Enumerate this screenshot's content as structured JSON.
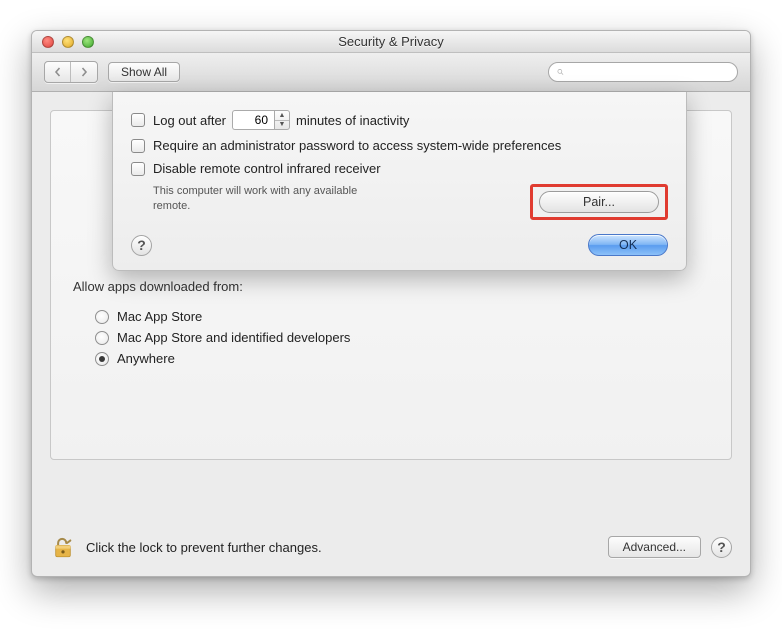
{
  "window": {
    "title": "Security & Privacy"
  },
  "toolbar": {
    "show_all_label": "Show All",
    "search_placeholder": ""
  },
  "sheet": {
    "logout": {
      "label_before": "Log out after",
      "value": "60",
      "label_after": "minutes of inactivity",
      "checked": false
    },
    "admin": {
      "label": "Require an administrator password to access system-wide preferences",
      "checked": false
    },
    "infrared": {
      "label": "Disable remote control infrared receiver",
      "checked": false,
      "note": "This computer will work with any available remote."
    },
    "pair_label": "Pair...",
    "ok_label": "OK"
  },
  "main": {
    "download_section_title": "Allow apps downloaded from:",
    "options": [
      {
        "label": "Mac App Store",
        "checked": false
      },
      {
        "label": "Mac App Store and identified developers",
        "checked": false
      },
      {
        "label": "Anywhere",
        "checked": true
      }
    ]
  },
  "footer": {
    "lock_text": "Click the lock to prevent further changes.",
    "advanced_label": "Advanced..."
  }
}
